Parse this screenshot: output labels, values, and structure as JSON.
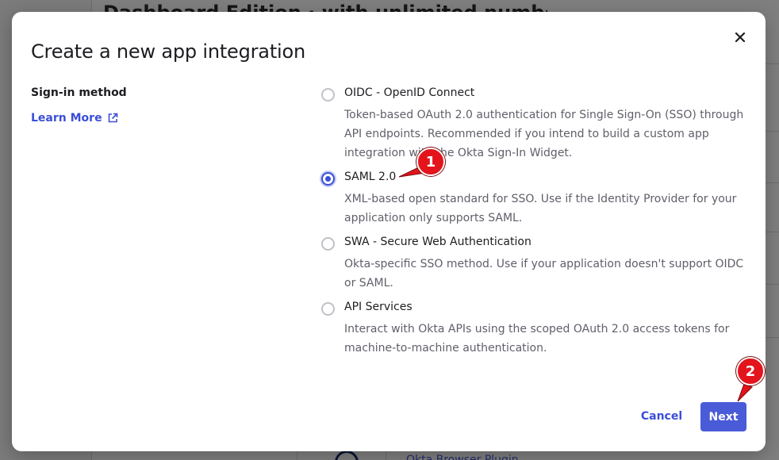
{
  "background": {
    "page_title_fragment": "Dashboard Edition  ·  with unlimited number of",
    "link_fragment": "Okta Browser Plugin"
  },
  "modal": {
    "title": "Create a new app integration",
    "close_icon": "close-icon",
    "sign_in_label": "Sign-in method",
    "learn_more_label": "Learn More",
    "learn_more_icon": "external-link-icon",
    "options": [
      {
        "title": "OIDC - OpenID Connect",
        "description": "Token-based OAuth 2.0 authentication for Single Sign-On (SSO) through API endpoints. Recommended if you intend to build a custom app integration with the Okta Sign-In Widget.",
        "selected": false
      },
      {
        "title": "SAML 2.0",
        "description": "XML-based open standard for SSO. Use if the Identity Provider for your application only supports SAML.",
        "selected": true
      },
      {
        "title": "SWA - Secure Web Authentication",
        "description": "Okta-specific SSO method. Use if your application doesn't support OIDC or SAML.",
        "selected": false
      },
      {
        "title": "API Services",
        "description": "Interact with Okta APIs using the scoped OAuth 2.0 access tokens for machine-to-machine authentication.",
        "selected": false
      }
    ],
    "cancel_label": "Cancel",
    "next_label": "Next"
  },
  "annotations": {
    "step1": "1",
    "step2": "2"
  },
  "colors": {
    "accent": "#4a5bd8",
    "callout": "#e3141b"
  }
}
